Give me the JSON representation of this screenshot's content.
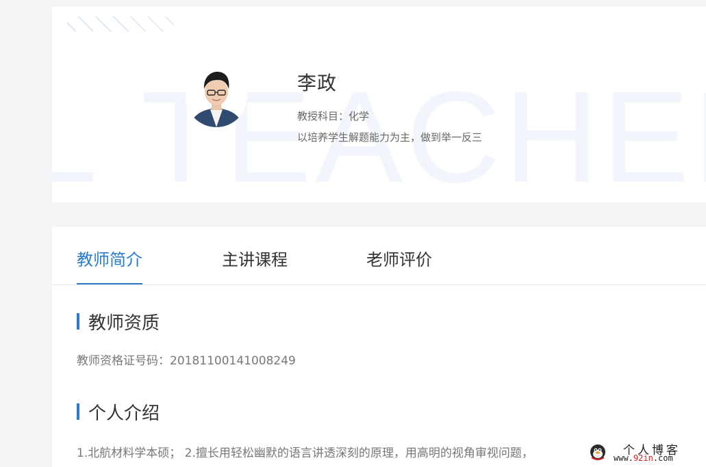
{
  "hero": {
    "watermark": "TEACHER",
    "watermark_left": "L",
    "teacher_name": "李政",
    "subject_line": "教授科目：化学",
    "motto": "以培养学生解题能力为主，做到举一反三"
  },
  "tabs": [
    {
      "label": "教师简介",
      "active": true
    },
    {
      "label": "主讲课程",
      "active": false
    },
    {
      "label": "老师评价",
      "active": false
    }
  ],
  "sections": {
    "qualification_title": "教师资质",
    "certificate_line": "教师资格证号码：20181100141008249",
    "intro_title": "个人介绍",
    "intro_text": "1.北航材料学本硕； 2.擅长用轻松幽默的语言讲透深刻的原理，用高明的视角审视问题，"
  },
  "blog_watermark": {
    "title": "个人博客",
    "url_prefix": "www.",
    "url_highlight": "92in",
    "url_suffix": ".com"
  },
  "colors": {
    "accent": "#2a7bd0",
    "page_bg": "#f4f5f7",
    "watermark": "#f2f6fc"
  },
  "icons": {
    "avatar": "teacher-portrait",
    "blog_mascot": "mascot-icon"
  }
}
